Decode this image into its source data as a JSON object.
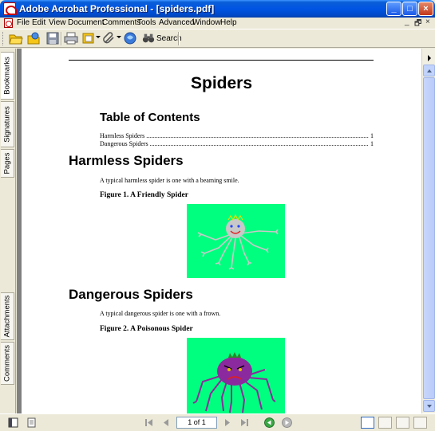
{
  "window": {
    "title": "Adobe Acrobat Professional - [spiders.pdf]",
    "controls": [
      "minimize",
      "maximize",
      "close"
    ]
  },
  "menubar": {
    "items": [
      "File",
      "Edit",
      "View",
      "Document",
      "Comments",
      "Tools",
      "Advanced",
      "Window",
      "Help"
    ],
    "mdi_controls": [
      "_",
      "🗗",
      "×"
    ]
  },
  "toolbar": {
    "search_label": "Search"
  },
  "navpane": {
    "tabs": [
      "Bookmarks",
      "Signatures",
      "Pages",
      "Attachments",
      "Comments"
    ]
  },
  "document": {
    "title": "Spiders",
    "toc_heading": "Table of Contents",
    "toc": [
      {
        "label": "Harmless Spiders",
        "page": "1"
      },
      {
        "label": "Dangerous Spiders",
        "page": "1"
      }
    ],
    "sections": [
      {
        "heading": "Harmless Spiders",
        "text": "A typical harmless spider is one with a beaming smile.",
        "caption": "Figure 1. A Friendly Spider"
      },
      {
        "heading": "Dangerous Spiders",
        "text": "A typical dangerous spider is one with a frown.",
        "caption": "Figure 2. A Poisonous Spider"
      }
    ]
  },
  "statusbar": {
    "page_indicator": "1 of 1"
  }
}
